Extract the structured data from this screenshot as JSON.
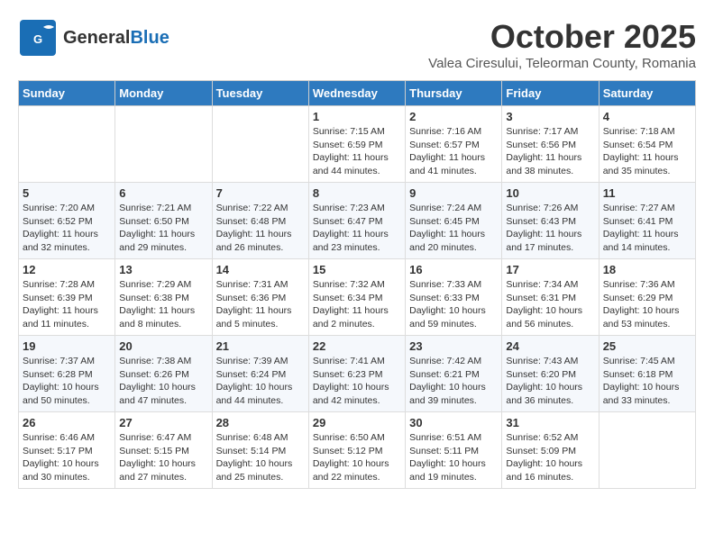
{
  "header": {
    "logo_general": "General",
    "logo_blue": "Blue",
    "month": "October 2025",
    "location": "Valea Ciresului, Teleorman County, Romania"
  },
  "weekdays": [
    "Sunday",
    "Monday",
    "Tuesday",
    "Wednesday",
    "Thursday",
    "Friday",
    "Saturday"
  ],
  "weeks": [
    [
      {
        "day": "",
        "info": ""
      },
      {
        "day": "",
        "info": ""
      },
      {
        "day": "",
        "info": ""
      },
      {
        "day": "1",
        "info": "Sunrise: 7:15 AM\nSunset: 6:59 PM\nDaylight: 11 hours and 44 minutes."
      },
      {
        "day": "2",
        "info": "Sunrise: 7:16 AM\nSunset: 6:57 PM\nDaylight: 11 hours and 41 minutes."
      },
      {
        "day": "3",
        "info": "Sunrise: 7:17 AM\nSunset: 6:56 PM\nDaylight: 11 hours and 38 minutes."
      },
      {
        "day": "4",
        "info": "Sunrise: 7:18 AM\nSunset: 6:54 PM\nDaylight: 11 hours and 35 minutes."
      }
    ],
    [
      {
        "day": "5",
        "info": "Sunrise: 7:20 AM\nSunset: 6:52 PM\nDaylight: 11 hours and 32 minutes."
      },
      {
        "day": "6",
        "info": "Sunrise: 7:21 AM\nSunset: 6:50 PM\nDaylight: 11 hours and 29 minutes."
      },
      {
        "day": "7",
        "info": "Sunrise: 7:22 AM\nSunset: 6:48 PM\nDaylight: 11 hours and 26 minutes."
      },
      {
        "day": "8",
        "info": "Sunrise: 7:23 AM\nSunset: 6:47 PM\nDaylight: 11 hours and 23 minutes."
      },
      {
        "day": "9",
        "info": "Sunrise: 7:24 AM\nSunset: 6:45 PM\nDaylight: 11 hours and 20 minutes."
      },
      {
        "day": "10",
        "info": "Sunrise: 7:26 AM\nSunset: 6:43 PM\nDaylight: 11 hours and 17 minutes."
      },
      {
        "day": "11",
        "info": "Sunrise: 7:27 AM\nSunset: 6:41 PM\nDaylight: 11 hours and 14 minutes."
      }
    ],
    [
      {
        "day": "12",
        "info": "Sunrise: 7:28 AM\nSunset: 6:39 PM\nDaylight: 11 hours and 11 minutes."
      },
      {
        "day": "13",
        "info": "Sunrise: 7:29 AM\nSunset: 6:38 PM\nDaylight: 11 hours and 8 minutes."
      },
      {
        "day": "14",
        "info": "Sunrise: 7:31 AM\nSunset: 6:36 PM\nDaylight: 11 hours and 5 minutes."
      },
      {
        "day": "15",
        "info": "Sunrise: 7:32 AM\nSunset: 6:34 PM\nDaylight: 11 hours and 2 minutes."
      },
      {
        "day": "16",
        "info": "Sunrise: 7:33 AM\nSunset: 6:33 PM\nDaylight: 10 hours and 59 minutes."
      },
      {
        "day": "17",
        "info": "Sunrise: 7:34 AM\nSunset: 6:31 PM\nDaylight: 10 hours and 56 minutes."
      },
      {
        "day": "18",
        "info": "Sunrise: 7:36 AM\nSunset: 6:29 PM\nDaylight: 10 hours and 53 minutes."
      }
    ],
    [
      {
        "day": "19",
        "info": "Sunrise: 7:37 AM\nSunset: 6:28 PM\nDaylight: 10 hours and 50 minutes."
      },
      {
        "day": "20",
        "info": "Sunrise: 7:38 AM\nSunset: 6:26 PM\nDaylight: 10 hours and 47 minutes."
      },
      {
        "day": "21",
        "info": "Sunrise: 7:39 AM\nSunset: 6:24 PM\nDaylight: 10 hours and 44 minutes."
      },
      {
        "day": "22",
        "info": "Sunrise: 7:41 AM\nSunset: 6:23 PM\nDaylight: 10 hours and 42 minutes."
      },
      {
        "day": "23",
        "info": "Sunrise: 7:42 AM\nSunset: 6:21 PM\nDaylight: 10 hours and 39 minutes."
      },
      {
        "day": "24",
        "info": "Sunrise: 7:43 AM\nSunset: 6:20 PM\nDaylight: 10 hours and 36 minutes."
      },
      {
        "day": "25",
        "info": "Sunrise: 7:45 AM\nSunset: 6:18 PM\nDaylight: 10 hours and 33 minutes."
      }
    ],
    [
      {
        "day": "26",
        "info": "Sunrise: 6:46 AM\nSunset: 5:17 PM\nDaylight: 10 hours and 30 minutes."
      },
      {
        "day": "27",
        "info": "Sunrise: 6:47 AM\nSunset: 5:15 PM\nDaylight: 10 hours and 27 minutes."
      },
      {
        "day": "28",
        "info": "Sunrise: 6:48 AM\nSunset: 5:14 PM\nDaylight: 10 hours and 25 minutes."
      },
      {
        "day": "29",
        "info": "Sunrise: 6:50 AM\nSunset: 5:12 PM\nDaylight: 10 hours and 22 minutes."
      },
      {
        "day": "30",
        "info": "Sunrise: 6:51 AM\nSunset: 5:11 PM\nDaylight: 10 hours and 19 minutes."
      },
      {
        "day": "31",
        "info": "Sunrise: 6:52 AM\nSunset: 5:09 PM\nDaylight: 10 hours and 16 minutes."
      },
      {
        "day": "",
        "info": ""
      }
    ]
  ]
}
